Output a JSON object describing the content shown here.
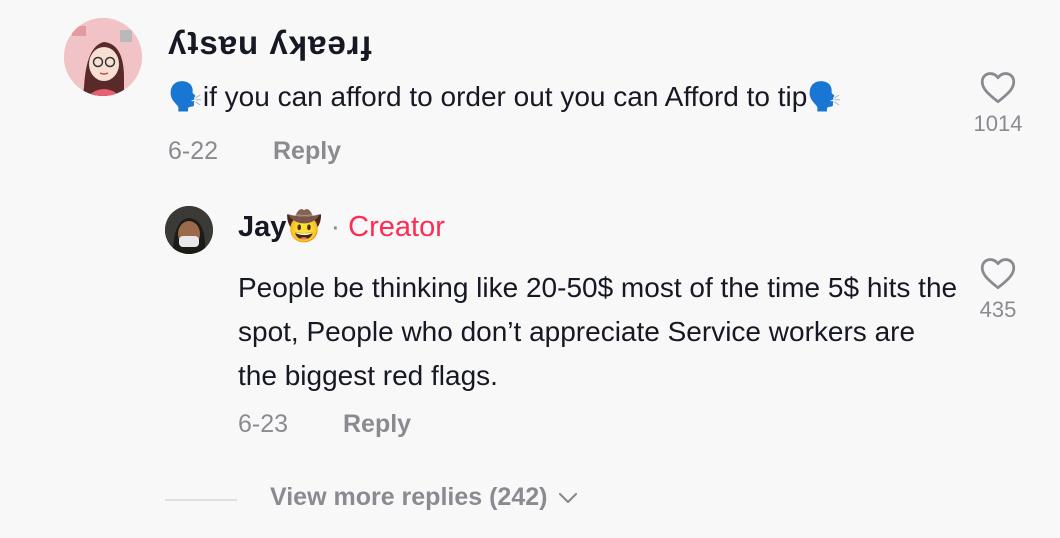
{
  "comment": {
    "username": "ʎʇsɐu ʎʞɐǝɹɟ",
    "text": "🗣️if you can afford to order out you can Afford to tip🗣️",
    "date": "6-22",
    "reply_label": "Reply",
    "likes": "1014"
  },
  "reply": {
    "username": "Jay🤠",
    "dot": "·",
    "badge": "Creator",
    "text": "People be thinking like 20-50$ most of the time 5$ hits the spot, People who don’t appreciate Service workers are the biggest red flags.",
    "date": "6-23",
    "reply_label": "Reply",
    "likes": "435"
  },
  "view_more": {
    "label": "View more replies (242)"
  },
  "colors": {
    "background": "#f8f8f8",
    "text": "#161823",
    "muted": "#8a8b91",
    "creator": "#fe2c55"
  },
  "icons": [
    "heart-icon",
    "chevron-down-icon"
  ]
}
